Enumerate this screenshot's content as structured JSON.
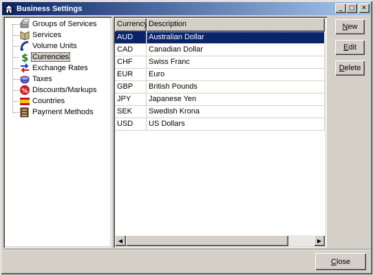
{
  "window": {
    "title": "Business Settings"
  },
  "tree": {
    "items": [
      {
        "label": "Groups of Services",
        "icon": "groups-icon"
      },
      {
        "label": "Services",
        "icon": "services-icon"
      },
      {
        "label": "Volume Units",
        "icon": "volume-icon"
      },
      {
        "label": "Currencies",
        "icon": "dollar-icon",
        "selected": true
      },
      {
        "label": "Exchange Rates",
        "icon": "exchange-arrows-icon"
      },
      {
        "label": "Taxes",
        "icon": "taxes-icon"
      },
      {
        "label": "Discounts/Markups",
        "icon": "percent-icon"
      },
      {
        "label": "Countries",
        "icon": "flag-icon"
      },
      {
        "label": "Payment Methods",
        "icon": "payment-icon"
      }
    ]
  },
  "grid": {
    "columns": [
      "Currency",
      "Description"
    ],
    "rows": [
      [
        "AUD",
        "Australian Dollar"
      ],
      [
        "CAD",
        "Canadian Dollar"
      ],
      [
        "CHF",
        "Swiss Franc"
      ],
      [
        "EUR",
        "Euro"
      ],
      [
        "GBP",
        "British Pounds"
      ],
      [
        "JPY",
        "Japanese Yen"
      ],
      [
        "SEK",
        "Swedish Krona"
      ],
      [
        "USD",
        "US Dollars"
      ]
    ],
    "selected_row": 0
  },
  "buttons": {
    "new": "New",
    "edit": "Edit",
    "delete": "Delete",
    "close": "Close"
  },
  "titlebar_buttons": {
    "minimize": "_",
    "maximize": "□",
    "close": "✕"
  },
  "colors": {
    "selection": "#0a246a",
    "titlebar_start": "#0a246a",
    "titlebar_end": "#a6caf0",
    "face": "#d4d0c8"
  }
}
